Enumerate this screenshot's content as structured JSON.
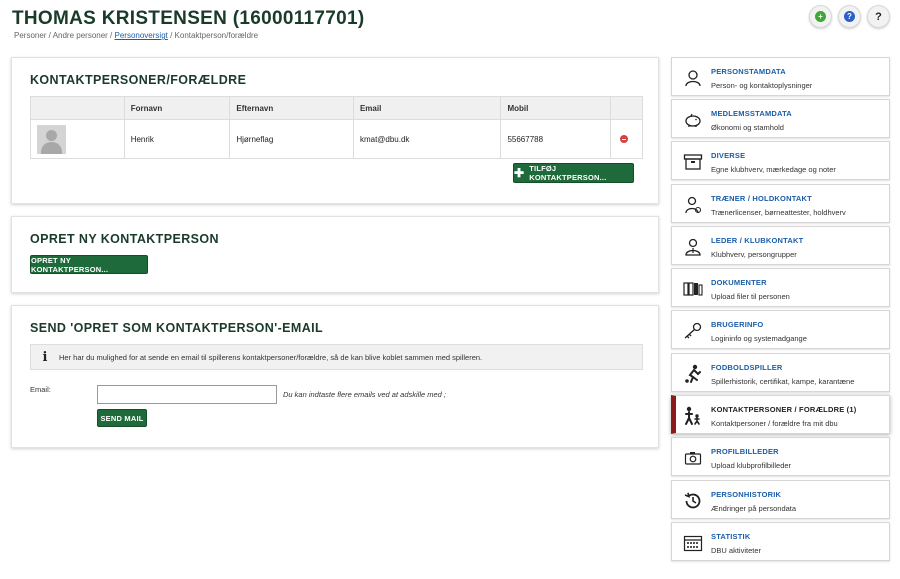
{
  "header": {
    "title": "THOMAS KRISTENSEN (16000117701)",
    "breadcrumb": {
      "part1": "Personer / Andre personer / ",
      "link": "Personoversigt",
      "part2": " / Kontaktperson/forældre"
    },
    "help_label": "?"
  },
  "contacts_card": {
    "title": "KONTAKTPERSONER/FORÆLDRE",
    "columns": [
      "",
      "Fornavn",
      "Efternavn",
      "Email",
      "Mobil",
      ""
    ],
    "rows": [
      {
        "fornavn": "Henrik",
        "efternavn": "Hjørneflag",
        "email": "kmat@dbu.dk",
        "mobil": "55667788"
      }
    ],
    "add_button": "TILFØJ KONTAKTPERSON..."
  },
  "create_card": {
    "title": "OPRET NY KONTAKTPERSON",
    "button": "OPRET NY KONTAKTPERSON..."
  },
  "email_card": {
    "title": "SEND 'OPRET SOM KONTAKTPERSON'-EMAIL",
    "info": "Her har du mulighed for at sende en email til spillerens kontaktpersoner/forældre, så de kan blive koblet sammen med spilleren.",
    "email_label": "Email:",
    "email_value": "",
    "email_hint": "Du kan indtaste flere emails ved at adskille med ;",
    "send_button": "SEND MAIL"
  },
  "sidebar": {
    "items": [
      {
        "title": "PERSONSTAMDATA",
        "subtitle": "Person- og kontaktoplysninger",
        "icon": "person-icon"
      },
      {
        "title": "MEDLEMSSTAMDATA",
        "subtitle": "Økonomi og stamhold",
        "icon": "piggy-bank-icon"
      },
      {
        "title": "DIVERSE",
        "subtitle": "Egne klubhverv, mærkedage og noter",
        "icon": "archive-box-icon"
      },
      {
        "title": "TRÆNER / HOLDKONTAKT",
        "subtitle": "Trænerlicenser, børneattester, holdhverv",
        "icon": "coach-icon"
      },
      {
        "title": "LEDER / KLUBKONTAKT",
        "subtitle": "Klubhverv, persongrupper",
        "icon": "leader-icon"
      },
      {
        "title": "DOKUMENTER",
        "subtitle": "Upload filer til personen",
        "icon": "binders-icon"
      },
      {
        "title": "BRUGERINFO",
        "subtitle": "Logininfo og systemadgange",
        "icon": "key-icon"
      },
      {
        "title": "FODBOLDSPILLER",
        "subtitle": "Spillerhistorik, certifikat, kampe, karantæne",
        "icon": "football-player-icon"
      },
      {
        "title": "KONTAKTPERSONER / FORÆLDRE (1)",
        "subtitle": "Kontaktpersoner / forældre fra mit dbu",
        "icon": "parent-child-icon"
      },
      {
        "title": "PROFILBILLEDER",
        "subtitle": "Upload klubprofilbilleder",
        "icon": "camera-icon"
      },
      {
        "title": "PERSONHISTORIK",
        "subtitle": "Ændringer på persondata",
        "icon": "history-icon"
      },
      {
        "title": "STATISTIK",
        "subtitle": "DBU aktiviteter",
        "icon": "calendar-icon"
      }
    ]
  },
  "colors": {
    "brand_green": "#1e6a3a",
    "link_blue": "#1b5ea8",
    "active_marker": "#8a1c1c"
  }
}
